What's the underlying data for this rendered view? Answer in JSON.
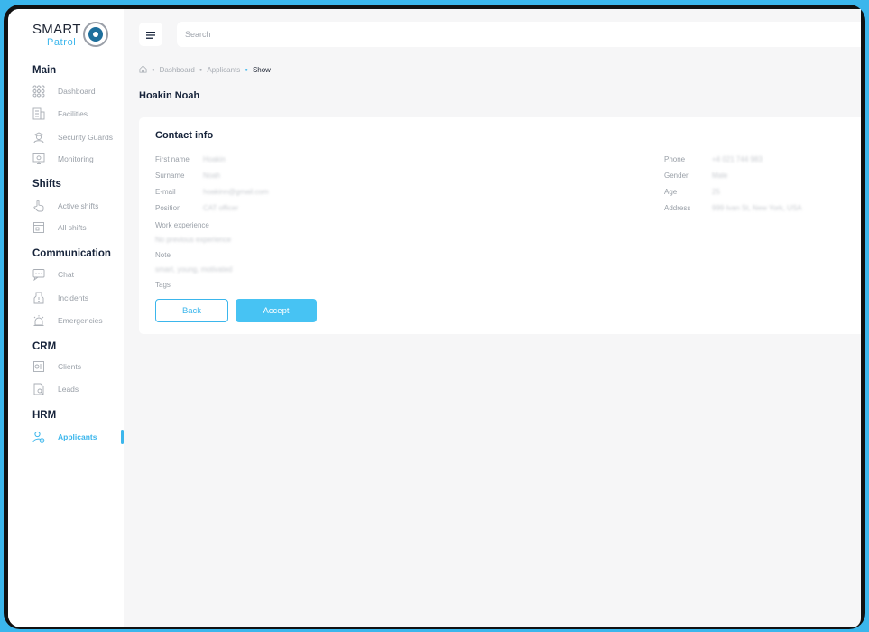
{
  "app": {
    "logo_primary": "SMART",
    "logo_secondary": "Patrol",
    "accent_color": "#3bb6ec"
  },
  "sidebar": {
    "sections": [
      {
        "title": "Main",
        "items": [
          {
            "label": "Dashboard",
            "icon": "grid-icon"
          },
          {
            "label": "Facilities",
            "icon": "building-icon"
          },
          {
            "label": "Security Guards",
            "icon": "guard-icon"
          },
          {
            "label": "Monitoring",
            "icon": "monitor-icon"
          }
        ]
      },
      {
        "title": "Shifts",
        "items": [
          {
            "label": "Active shifts",
            "icon": "hand-pointer-icon"
          },
          {
            "label": "All shifts",
            "icon": "calendar-icon"
          }
        ]
      },
      {
        "title": "Communication",
        "items": [
          {
            "label": "Chat",
            "icon": "chat-icon"
          },
          {
            "label": "Incidents",
            "icon": "incident-icon"
          },
          {
            "label": "Emergencies",
            "icon": "siren-icon"
          }
        ]
      },
      {
        "title": "CRM",
        "items": [
          {
            "label": "Clients",
            "icon": "clients-icon"
          },
          {
            "label": "Leads",
            "icon": "leads-icon"
          }
        ]
      },
      {
        "title": "HRM",
        "items": [
          {
            "label": "Applicants",
            "icon": "applicant-icon",
            "active": true
          }
        ]
      }
    ]
  },
  "header": {
    "search_placeholder": "Search"
  },
  "breadcrumb": {
    "items": [
      "Dashboard",
      "Applicants"
    ],
    "current": "Show"
  },
  "page": {
    "title": "Hoakin Noah"
  },
  "contact": {
    "title": "Contact info",
    "left_fields": [
      {
        "label": "First name",
        "value": "Hoakin"
      },
      {
        "label": "Surname",
        "value": "Noah"
      },
      {
        "label": "E-mail",
        "value": "hoakinn@gmail.com"
      },
      {
        "label": "Position",
        "value": "CAT officer"
      }
    ],
    "right_fields": [
      {
        "label": "Phone",
        "value": "+4 021 744 983"
      },
      {
        "label": "Gender",
        "value": "Male"
      },
      {
        "label": "Age",
        "value": "25"
      },
      {
        "label": "Address",
        "value": "999 Ivan St, New York, USA"
      }
    ],
    "work_experience_label": "Work experience",
    "work_experience_value": "No previous experience",
    "note_label": "Note",
    "note_value": "smart, young, motivated",
    "tags_label": "Tags",
    "back_label": "Back",
    "accept_label": "Accept"
  }
}
